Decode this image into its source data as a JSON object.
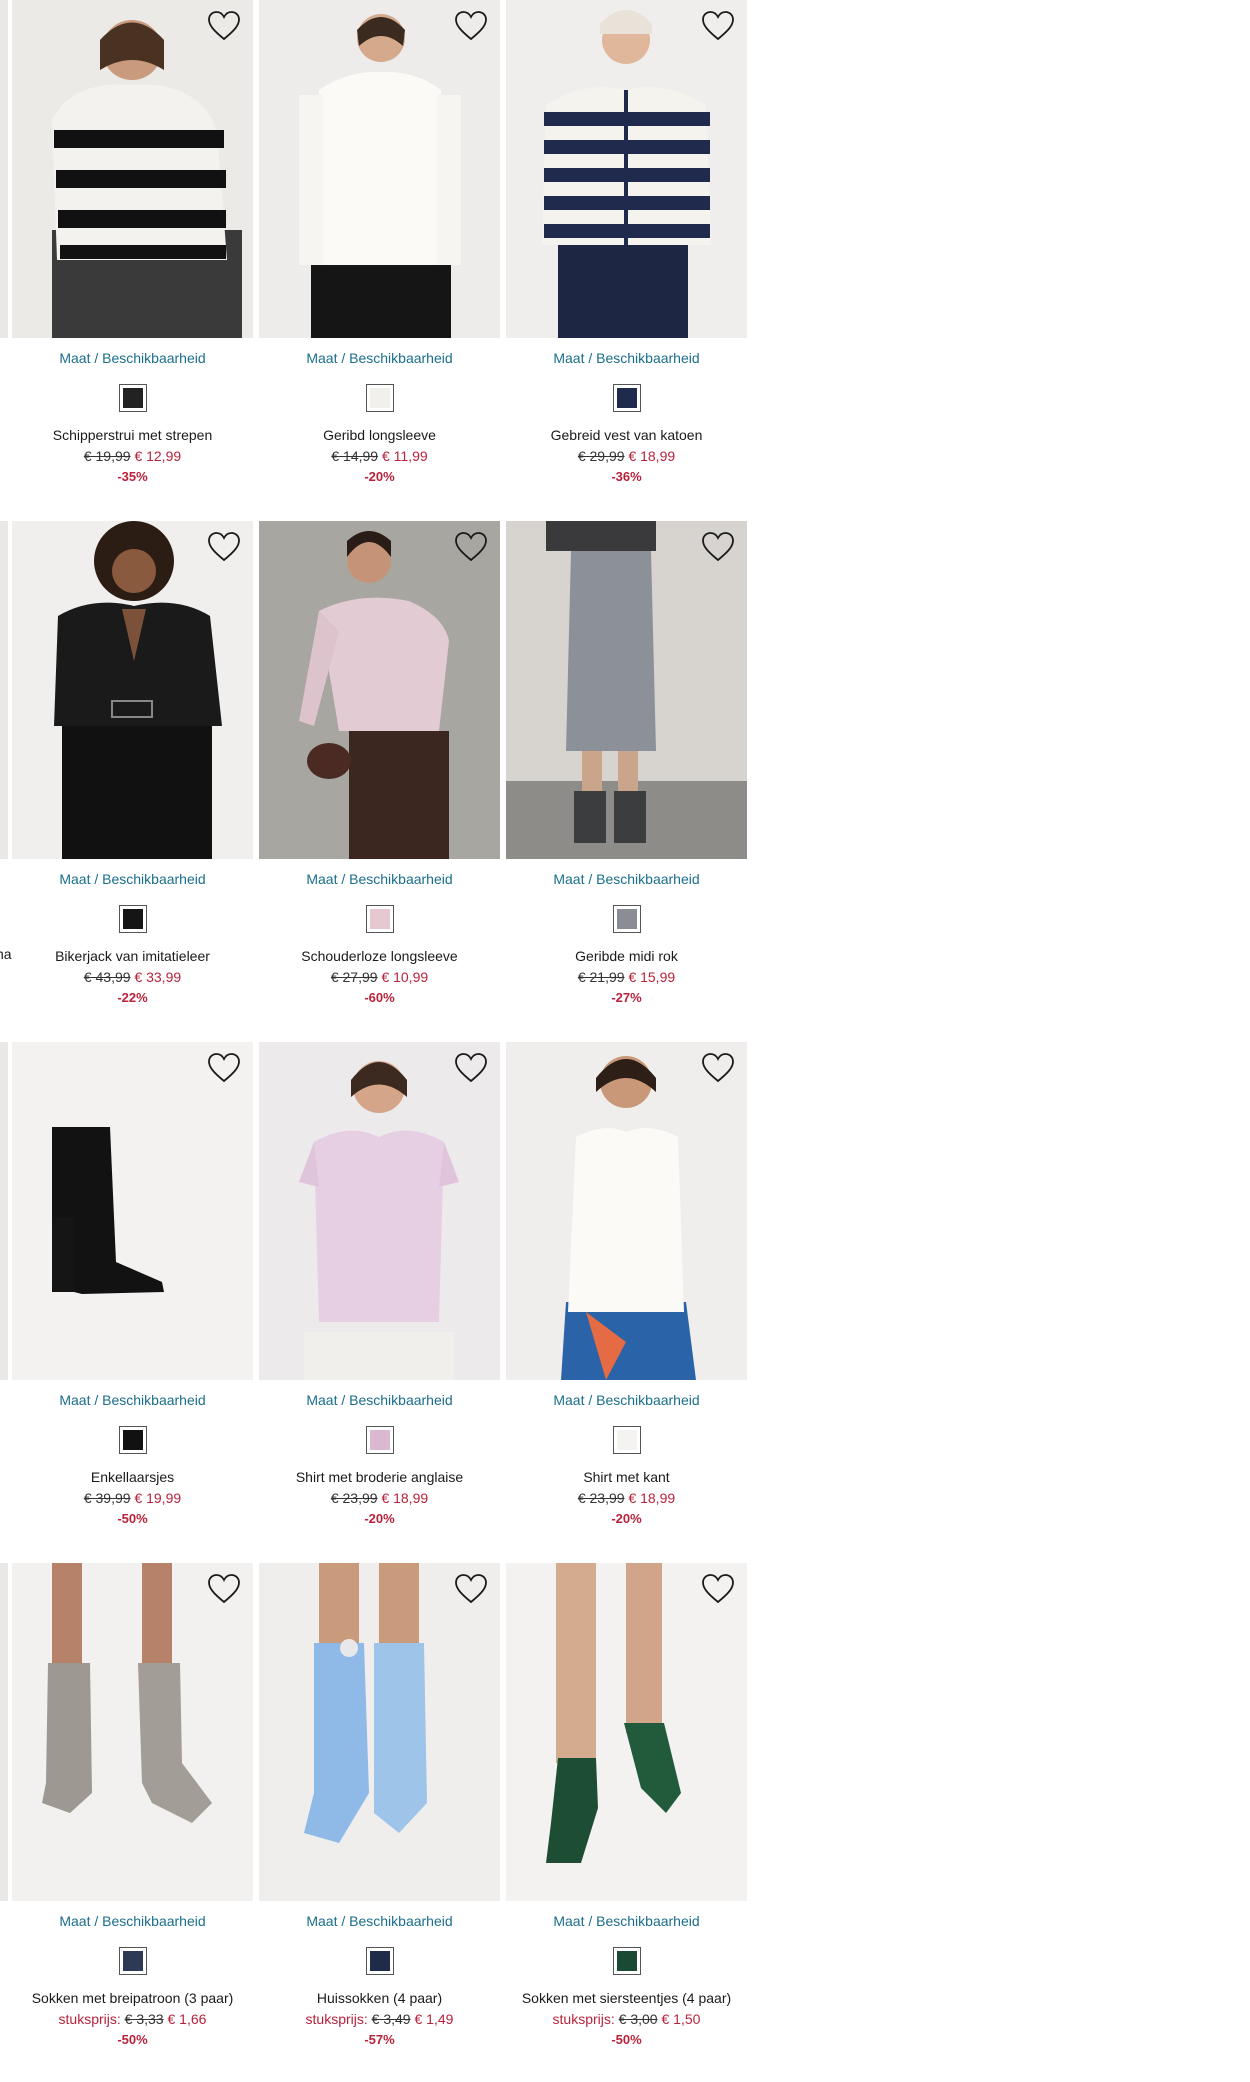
{
  "left_cut_texts": [
    "na"
  ],
  "products": [
    {
      "name": "Schipperstrui met strepen",
      "size_label": "Maat / Beschikbaarheid",
      "old_price": "€ 19,99",
      "new_price": "€ 12,99",
      "discount": "-35%",
      "unit_label": "",
      "image": "woman-striped-sweater",
      "swatch_icon": "striped-sweater-icon",
      "swatch_color": "#222222"
    },
    {
      "name": "Geribd longsleeve",
      "size_label": "Maat / Beschikbaarheid",
      "old_price": "€ 14,99",
      "new_price": "€ 11,99",
      "discount": "-20%",
      "unit_label": "",
      "image": "woman-white-longsleeve",
      "swatch_icon": "white-top-icon",
      "swatch_color": "#f2f0ea"
    },
    {
      "name": "Gebreid vest van katoen",
      "size_label": "Maat / Beschikbaarheid",
      "old_price": "€ 29,99",
      "new_price": "€ 18,99",
      "discount": "-36%",
      "unit_label": "",
      "image": "woman-navy-striped-cardigan",
      "swatch_icon": "striped-cardigan-icon",
      "swatch_color": "#1f2a4d"
    },
    {
      "name": "Bikerjack van imitatieleer",
      "size_label": "Maat / Beschikbaarheid",
      "old_price": "€ 43,99",
      "new_price": "€ 33,99",
      "discount": "-22%",
      "unit_label": "",
      "image": "woman-leather-jacket",
      "swatch_icon": "black-jacket-icon",
      "swatch_color": "#151515"
    },
    {
      "name": "Schouderloze longsleeve",
      "size_label": "Maat / Beschikbaarheid",
      "old_price": "€ 27,99",
      "new_price": "€ 10,99",
      "discount": "-60%",
      "unit_label": "",
      "image": "woman-off-shoulder-pink",
      "swatch_icon": "pink-top-icon",
      "swatch_color": "#e6c8d0"
    },
    {
      "name": "Geribde midi rok",
      "size_label": "Maat / Beschikbaarheid",
      "old_price": "€ 21,99",
      "new_price": "€ 15,99",
      "discount": "-27%",
      "unit_label": "",
      "image": "grey-midi-skirt",
      "swatch_icon": "grey-skirt-icon",
      "swatch_color": "#8a8d93"
    },
    {
      "name": "Enkellaarsjes",
      "size_label": "Maat / Beschikbaarheid",
      "old_price": "€ 39,99",
      "new_price": "€ 19,99",
      "discount": "-50%",
      "unit_label": "",
      "image": "black-ankle-boot",
      "swatch_icon": "boot-icon",
      "swatch_color": "#111111"
    },
    {
      "name": "Shirt met broderie anglaise",
      "size_label": "Maat / Beschikbaarheid",
      "old_price": "€ 23,99",
      "new_price": "€ 18,99",
      "discount": "-20%",
      "unit_label": "",
      "image": "woman-lilac-blouse",
      "swatch_icon": "lilac-top-icon",
      "swatch_color": "#d9b8d0"
    },
    {
      "name": "Shirt met kant",
      "size_label": "Maat / Beschikbaarheid",
      "old_price": "€ 23,99",
      "new_price": "€ 18,99",
      "discount": "-20%",
      "unit_label": "",
      "image": "woman-white-lace-shirt",
      "swatch_icon": "white-shirt-icon",
      "swatch_color": "#f4f3ef"
    },
    {
      "name": "Sokken met breipatroon (3 paar)",
      "size_label": "Maat / Beschikbaarheid",
      "old_price": "€ 3,33",
      "new_price": "€ 1,66",
      "discount": "-50%",
      "unit_label": "stuksprijs:",
      "image": "grey-knit-socks",
      "swatch_icon": "socks-icon",
      "swatch_color": "#2d3a55"
    },
    {
      "name": "Huissokken (4 paar)",
      "size_label": "Maat / Beschikbaarheid",
      "old_price": "€ 3,49",
      "new_price": "€ 1,49",
      "discount": "-57%",
      "unit_label": "stuksprijs:",
      "image": "blue-fluffy-socks",
      "swatch_icon": "house-socks-icon",
      "swatch_color": "#1e2c4a"
    },
    {
      "name": "Sokken met siersteentjes (4 paar)",
      "size_label": "Maat / Beschikbaarheid",
      "old_price": "€ 3,00",
      "new_price": "€ 1,50",
      "discount": "-50%",
      "unit_label": "stuksprijs:",
      "image": "green-socks",
      "swatch_icon": "green-socks-icon",
      "swatch_color": "#1a4a33"
    }
  ]
}
